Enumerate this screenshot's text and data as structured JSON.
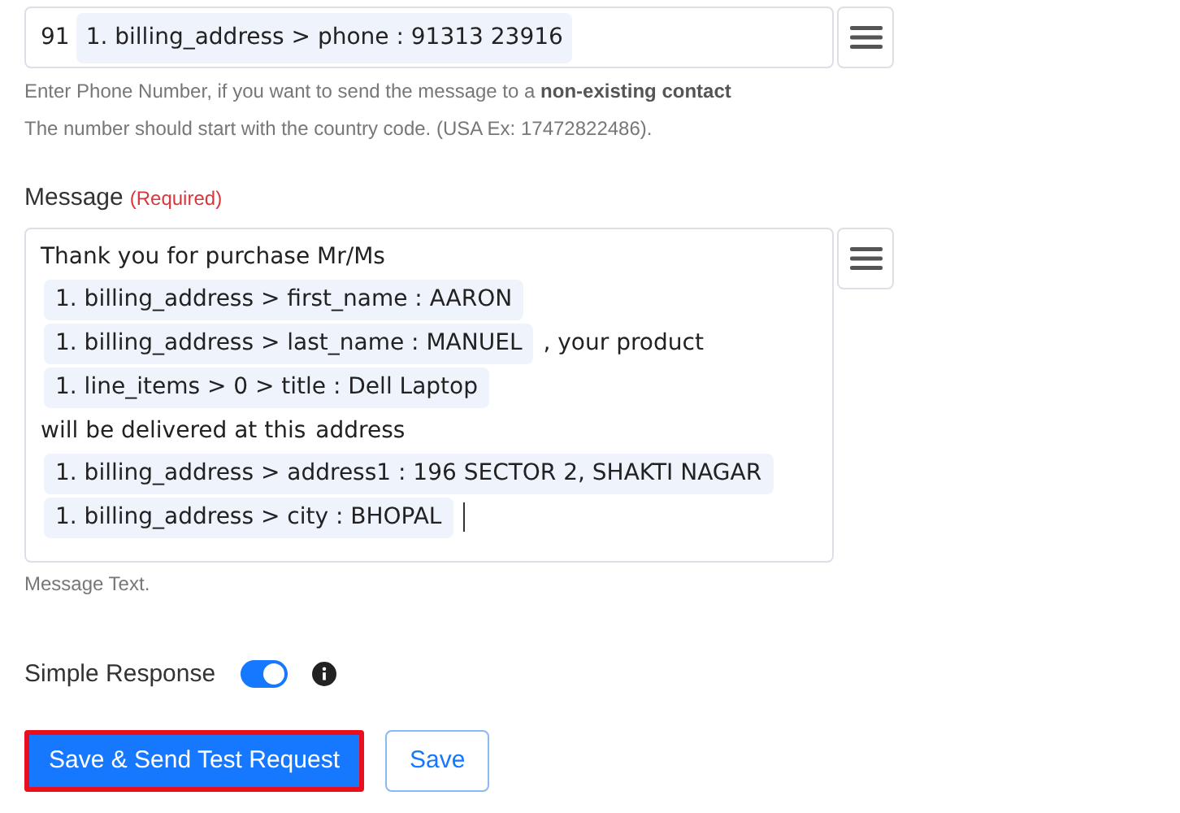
{
  "phone_field": {
    "prefix": "91",
    "token": "1. billing_address > phone : 91313 23916"
  },
  "phone_hints": [
    "Enter Phone Number, if you want to send the message to a **non-existing contact**",
    "The number should start with the country code. (USA Ex: 17472822486)."
  ],
  "message": {
    "label": "Message",
    "required": "(Required)",
    "segments": [
      {
        "kind": "text",
        "text": "Thank you for purchase Mr/Ms"
      },
      {
        "kind": "token",
        "text": "1. billing_address > first_name : AARON"
      },
      {
        "kind": "token",
        "text": "1. billing_address > last_name : MANUEL"
      },
      {
        "kind": "text",
        "text": ", your product"
      },
      {
        "kind": "token",
        "text": "1. line_items > 0 > title : Dell Laptop"
      },
      {
        "kind": "text",
        "text": "will be delivered at this"
      },
      {
        "kind": "text",
        "text": "address"
      },
      {
        "kind": "token",
        "text": "1. billing_address > address1 : 196 SECTOR 2, SHAKTI NAGAR"
      },
      {
        "kind": "token",
        "text": "1. billing_address > city : BHOPAL"
      }
    ],
    "hint": "Message Text."
  },
  "simple_response": {
    "label": "Simple Response",
    "on": true
  },
  "buttons": [
    {
      "label": "Save & Send Test Request",
      "kind": "primary"
    },
    {
      "label": "Save",
      "kind": "secondary"
    }
  ]
}
